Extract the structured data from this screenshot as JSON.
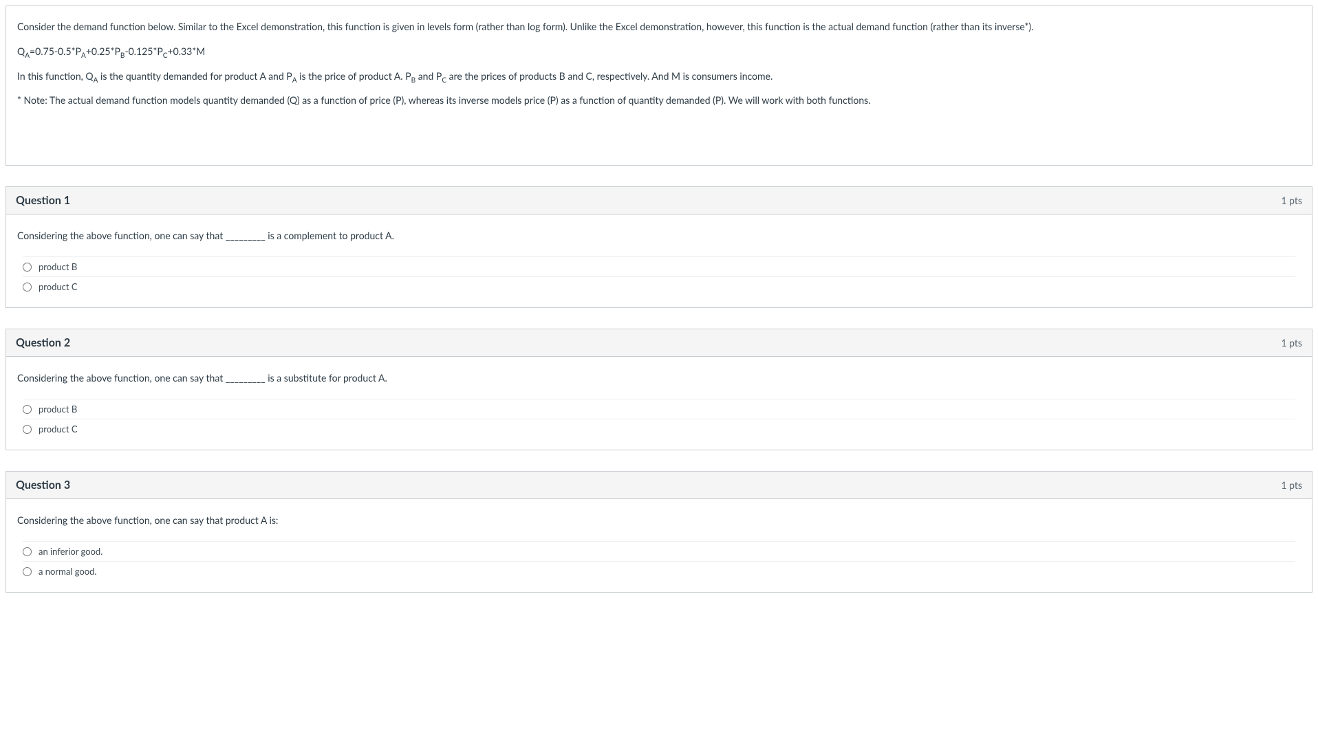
{
  "intro": {
    "p1": "Consider the demand function below. Similar to the Excel demonstration, this function is given in levels form (rather than log form). Unlike the Excel demonstration, however, this function is the actual demand function (rather than its inverse*).",
    "formula_parts": {
      "lhs_var": "Q",
      "lhs_sub": "A",
      "eq": "=0.75-0.5*P",
      "sub1": "A",
      "plus025": "+0.25*P",
      "sub2": "B",
      "minus0125": "-0.125*P",
      "sub3": "C",
      "plus033m": "+0.33*M"
    },
    "p3_a": "In this function, Q",
    "p3_a_sub": "A",
    "p3_b": " is the quantity demanded for product A and P",
    "p3_b_sub": "A",
    "p3_c": " is the price of product A. P",
    "p3_c_sub": "B",
    "p3_d": " and P",
    "p3_d_sub": "C",
    "p3_e": " are the prices of products B and C, respectively. And M is consumers income.",
    "p4": "* Note: The actual demand function models quantity demanded (Q) as a function of price (P), whereas its inverse models price (P) as a function of quantity demanded (P). We will work with both functions."
  },
  "questions": [
    {
      "title": "Question 1",
      "pts": "1 pts",
      "prompt": "Considering the above function, one can say that _________ is a complement to product A.",
      "options": [
        "product B",
        "product C"
      ]
    },
    {
      "title": "Question 2",
      "pts": "1 pts",
      "prompt": "Considering the above function, one can say that _________ is a substitute for product A.",
      "options": [
        "product B",
        "product C"
      ]
    },
    {
      "title": "Question 3",
      "pts": "1 pts",
      "prompt": "Considering the above function, one can say that product A is:",
      "options": [
        "an inferior good.",
        "a normal good."
      ]
    }
  ]
}
